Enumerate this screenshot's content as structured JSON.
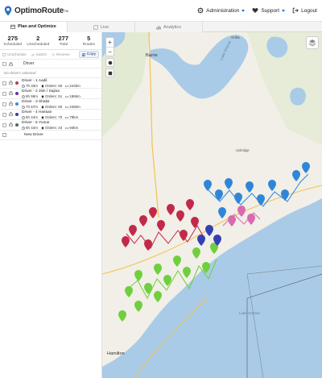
{
  "header": {
    "app_name": "OptimoRoute",
    "trademark": "TM",
    "menu": [
      {
        "label": "Administration",
        "icon": "gear-icon",
        "has_caret": true
      },
      {
        "label": "Support",
        "icon": "heart-icon",
        "has_caret": true
      },
      {
        "label": "Logout",
        "icon": "logout-icon",
        "has_caret": false
      }
    ]
  },
  "tabs": [
    {
      "label": "Plan and Optimize",
      "icon": "calendar-icon",
      "active": true
    },
    {
      "label": "Live",
      "icon": "map-icon",
      "active": false
    },
    {
      "label": "Analytics",
      "icon": "bar-chart-icon",
      "active": false
    }
  ],
  "stats": [
    {
      "value": "275",
      "label": "Scheduled"
    },
    {
      "value": "2",
      "label": "Unscheduled"
    },
    {
      "value": "277",
      "label": "Total"
    },
    {
      "value": "5",
      "label": "Routes"
    }
  ],
  "actions": {
    "unschedule": "Unschedule",
    "switch": "Switch",
    "reverse": "Reverse",
    "copy": "Copy"
  },
  "driver_column": "Driver",
  "no_driver": "No drivers selected",
  "drivers": [
    {
      "name": "Driver - 1 Aadil",
      "time": "7h 33m",
      "orders": "Orders: 50",
      "distance": "244km",
      "color": "#b23a5a"
    },
    {
      "name": "Driver - 2 Jitin / Sajina",
      "time": "6h 58m",
      "orders": "Orders: 51",
      "distance": "186km",
      "color": "#6b2fa6"
    },
    {
      "name": "Driver - 3 Shakir",
      "time": "7h 57m",
      "orders": "Orders: 60",
      "distance": "246km",
      "color": "#3a8fd6"
    },
    {
      "name": "Driver - 4 Hassan",
      "time": "6h 44m",
      "orders": "Orders: 70",
      "distance": "79km",
      "color": "#2e3fb5"
    },
    {
      "name": "Driver - 5 Yunus",
      "time": "6h 44m",
      "orders": "Orders: 44",
      "distance": "94km",
      "color": "#5b5f6b"
    }
  ],
  "new_driver": "New Driver",
  "map": {
    "labels": {
      "barrie": "Barrie",
      "lake_simcoe": "Lake Simcoe",
      "orillia": "Orillia",
      "uxbridge": "Uxbridge",
      "hamilton": "Hamilton",
      "lake_ontario": "Lake Ontario"
    },
    "colors": {
      "water": "#a9cbe8",
      "land": "#f1efe7",
      "route_red": "#c2294a",
      "route_green": "#6fcf3c",
      "route_blue": "#2f86d8",
      "route_pink": "#d96ab0",
      "route_navy": "#3340b5"
    }
  }
}
